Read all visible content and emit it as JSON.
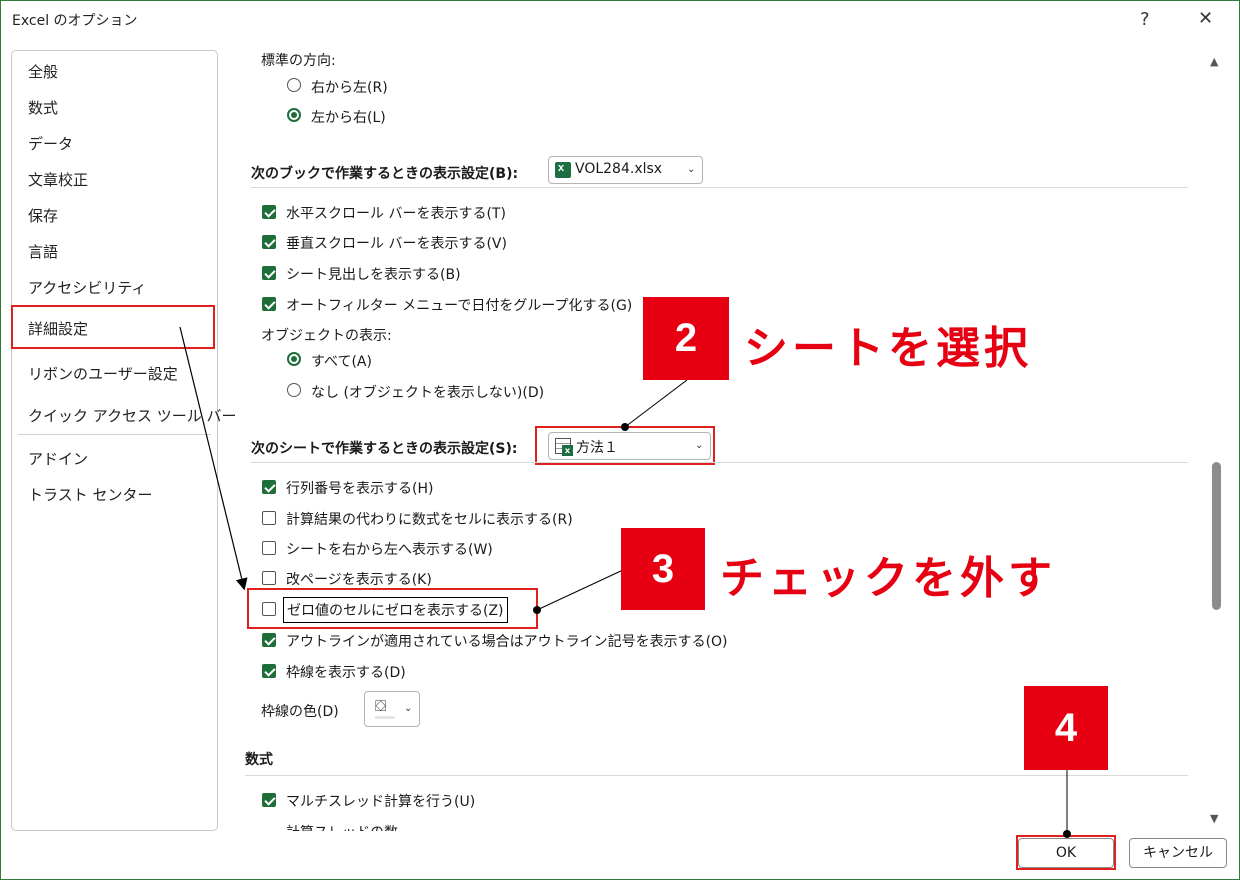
{
  "window": {
    "title": "Excel のオプション",
    "help_glyph": "?",
    "close_glyph": "✕"
  },
  "sidebar": {
    "items": [
      "全般",
      "数式",
      "データ",
      "文章校正",
      "保存",
      "言語",
      "アクセシビリティ",
      "詳細設定",
      "リボンのユーザー設定",
      "クイック アクセス ツール バー",
      "アドイン",
      "トラスト センター"
    ],
    "selected": "詳細設定"
  },
  "direction": {
    "label": "標準の方向:",
    "options": [
      {
        "label": "右から左(R)",
        "selected": false
      },
      {
        "label": "左から右(L)",
        "selected": true
      }
    ]
  },
  "workbook_section": {
    "label": "次のブックで作業するときの表示設定(B):",
    "dropdown_value": "VOL284.xlsx",
    "dropdown_icon": "excel-icon",
    "options": [
      {
        "label": "水平スクロール バーを表示する(T)",
        "checked": true
      },
      {
        "label": "垂直スクロール バーを表示する(V)",
        "checked": true
      },
      {
        "label": "シート見出しを表示する(B)",
        "checked": true
      },
      {
        "label": "オートフィルター メニューで日付をグループ化する(G)",
        "checked": true
      }
    ],
    "objects_label": "オブジェクトの表示:",
    "objects_options": [
      {
        "label": "すべて(A)",
        "selected": true
      },
      {
        "label": "なし (オブジェクトを表示しない)(D)",
        "selected": false
      }
    ]
  },
  "sheet_section": {
    "label": "次のシートで作業するときの表示設定(S):",
    "dropdown_value": "方法１",
    "dropdown_icon": "sheet-icon",
    "options": [
      {
        "label": "行列番号を表示する(H)",
        "checked": true
      },
      {
        "label": "計算結果の代わりに数式をセルに表示する(R)",
        "checked": false
      },
      {
        "label": "シートを右から左へ表示する(W)",
        "checked": false
      },
      {
        "label": "改ページを表示する(K)",
        "checked": false
      },
      {
        "label": "ゼロ値のセルにゼロを表示する(Z)",
        "checked": false
      },
      {
        "label": "アウトラインが適用されている場合はアウトライン記号を表示する(O)",
        "checked": true
      },
      {
        "label": "枠線を表示する(D)",
        "checked": true
      }
    ],
    "gridline_color_label": "枠線の色(D)",
    "gridline_color_icon": "paint-bucket-icon"
  },
  "formulas_section": {
    "label": "数式",
    "options": [
      {
        "label": "マルチスレッド計算を行う(U)",
        "checked": true
      }
    ],
    "partial_label": "計算スレッドの数"
  },
  "footer": {
    "ok_label": "OK",
    "cancel_label": "キャンセル"
  },
  "annotations": [
    {
      "number": "2",
      "caption": "シートを選択"
    },
    {
      "number": "3",
      "caption": "チェックを外す"
    },
    {
      "number": "4",
      "caption": ""
    }
  ],
  "colors": {
    "accent_green": "#1e6e3a",
    "annotation_red": "#e60012",
    "highlight_red": "#e0201c"
  }
}
